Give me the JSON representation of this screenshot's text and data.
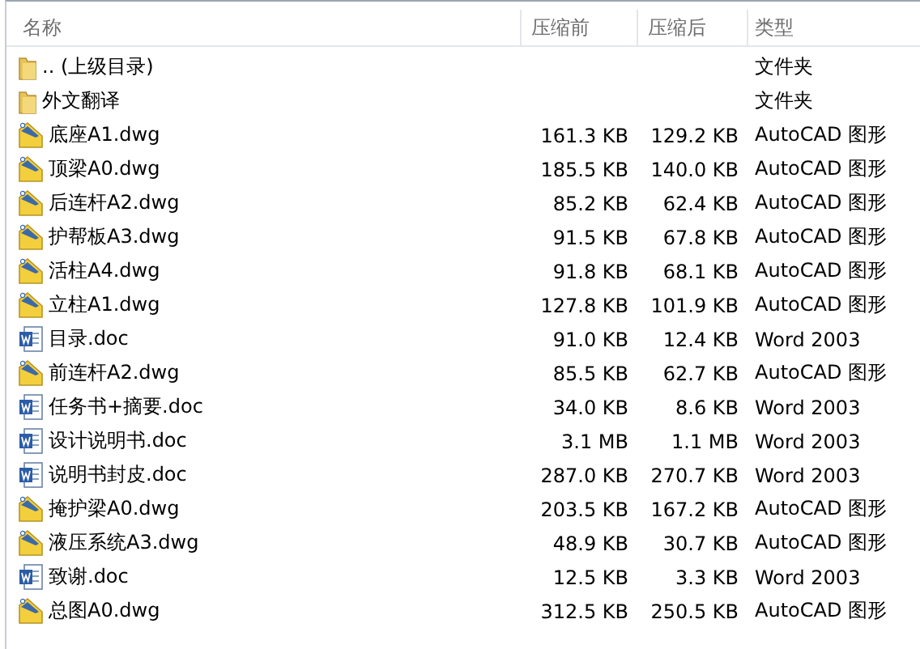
{
  "columns": [
    "名称",
    "压缩前",
    "压缩后",
    "类型"
  ],
  "rows": [
    {
      "kind": "folder",
      "name": ".. (上级目录)",
      "before": "",
      "after": "",
      "type": "文件夹"
    },
    {
      "kind": "folder",
      "name": "外文翻译",
      "type": "文件夹"
    },
    {
      "kind": "dwg",
      "name": "底座A1.dwg",
      "before": "161.3 KB",
      "after": "129.2 KB",
      "type": "AutoCAD 图形"
    },
    {
      "kind": "dwg",
      "name": "顶梁A0.dwg",
      "before": "185.5 KB",
      "after": "140.0 KB",
      "type": "AutoCAD 图形"
    },
    {
      "kind": "dwg",
      "name": "后连杆A2.dwg",
      "before": "85.2 KB",
      "after": "62.4 KB",
      "type": "AutoCAD 图形"
    },
    {
      "kind": "dwg",
      "name": "护帮板A3.dwg",
      "before": "91.5 KB",
      "after": "67.8 KB",
      "type": "AutoCAD 图形"
    },
    {
      "kind": "dwg",
      "name": "活柱A4.dwg",
      "before": "91.8 KB",
      "after": "68.1 KB",
      "type": "AutoCAD 图形"
    },
    {
      "kind": "dwg",
      "name": "立柱A1.dwg",
      "before": "127.8 KB",
      "after": "101.9 KB",
      "type": "AutoCAD 图形"
    },
    {
      "kind": "doc",
      "name": "目录.doc",
      "before": "91.0 KB",
      "after": "12.4 KB",
      "type": "Word 2003"
    },
    {
      "kind": "dwg",
      "name": "前连杆A2.dwg",
      "before": "85.5 KB",
      "after": "62.7 KB",
      "type": "AutoCAD 图形"
    },
    {
      "kind": "doc",
      "name": "任务书+摘要.doc",
      "before": "34.0 KB",
      "after": "8.6 KB",
      "type": "Word 2003"
    },
    {
      "kind": "doc",
      "name": "设计说明书.doc",
      "before": "3.1 MB",
      "after": "1.1 MB",
      "type": "Word 2003"
    },
    {
      "kind": "doc",
      "name": "说明书封皮.doc",
      "before": "287.0 KB",
      "after": "270.7 KB",
      "type": "Word 2003"
    },
    {
      "kind": "dwg",
      "name": "掩护梁A0.dwg",
      "before": "203.5 KB",
      "after": "167.2 KB",
      "type": "AutoCAD 图形"
    },
    {
      "kind": "dwg",
      "name": "液压系统A3.dwg",
      "before": "48.9 KB",
      "after": "30.7 KB",
      "type": "AutoCAD 图形"
    },
    {
      "kind": "doc",
      "name": "致谢.doc",
      "before": "12.5 KB",
      "after": "3.3 KB",
      "type": "Word 2003"
    },
    {
      "kind": "dwg",
      "name": "总图A0.dwg",
      "before": "312.5 KB",
      "after": "250.5 KB",
      "type": "AutoCAD 图形"
    }
  ]
}
